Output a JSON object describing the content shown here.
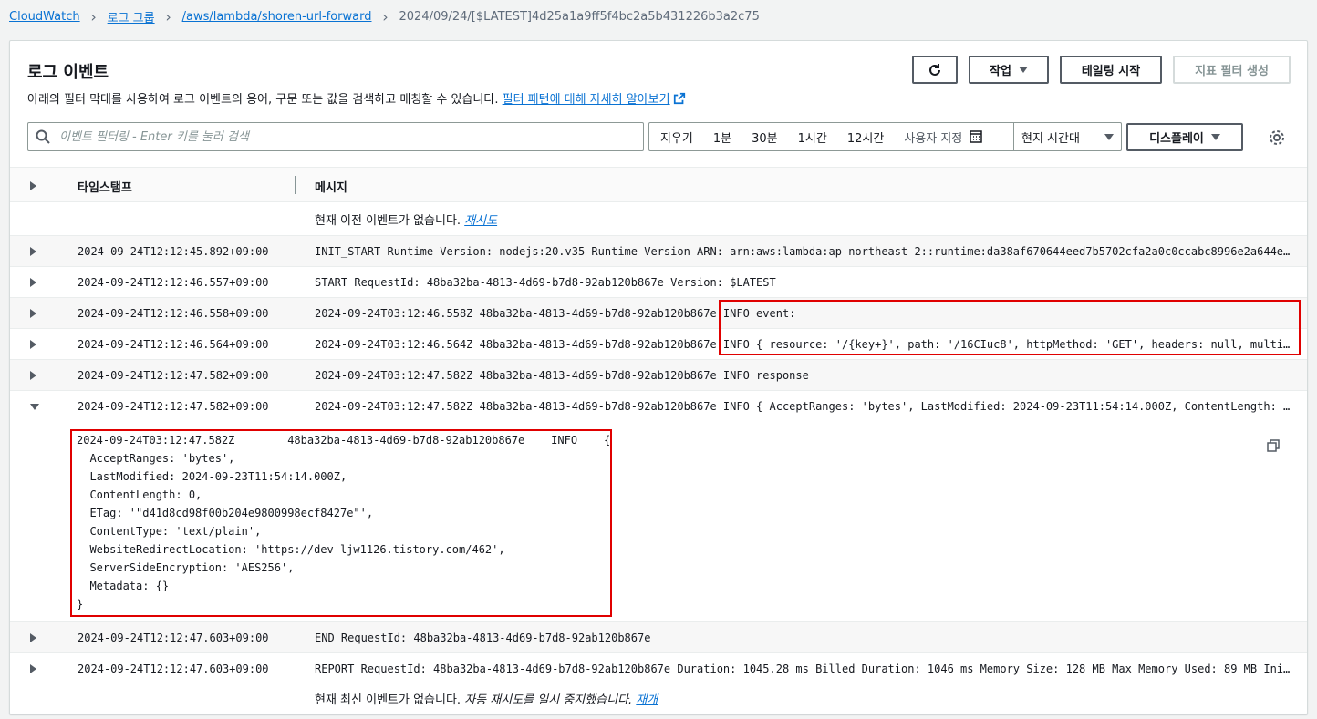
{
  "breadcrumb": {
    "items": [
      "CloudWatch",
      "로그 그룹",
      "/aws/lambda/shoren-url-forward"
    ],
    "current": "2024/09/24/[$LATEST]4d25a1a9ff5f4bc2a5b431226b3a2c75"
  },
  "header": {
    "title": "로그 이벤트",
    "description": "아래의 필터 막대를 사용하여 로그 이벤트의 용어, 구문 또는 값을 검색하고 매칭할 수 있습니다.",
    "learn_more": "필터 패턴에 대해 자세히 알아보기",
    "refresh_icon": "refresh-icon",
    "actions_label": "작업",
    "tailing_label": "테일링 시작",
    "metric_filter_label": "지표 필터 생성"
  },
  "filter": {
    "placeholder": "이벤트 필터링 - Enter 키를 눌러 검색",
    "ranges": [
      "지우기",
      "1분",
      "30분",
      "1시간",
      "12시간"
    ],
    "custom_label": "사용자 지정",
    "timezone": "현지 시간대",
    "display_label": "디스플레이"
  },
  "table": {
    "col_timestamp": "타임스탬프",
    "col_message": "메시지",
    "no_older": "현재 이전 이벤트가 없습니다.",
    "retry": "재시도",
    "no_newer": "현재 최신 이벤트가 없습니다.",
    "paused": "자동 재시도를 일시 중지했습니다.",
    "resume": "재개",
    "rows": [
      {
        "ts": "2024-09-24T12:12:45.892+09:00",
        "msg": "INIT_START Runtime Version: nodejs:20.v35 Runtime Version ARN: arn:aws:lambda:ap-northeast-2::runtime:da38af670644eed7b5702cfa2a0c0ccabc8996e2a644e..."
      },
      {
        "ts": "2024-09-24T12:12:46.557+09:00",
        "msg": "START RequestId: 48ba32ba-4813-4d69-b7d8-92ab120b867e Version: $LATEST"
      },
      {
        "ts": "2024-09-24T12:12:46.558+09:00",
        "msg": "2024-09-24T03:12:46.558Z 48ba32ba-4813-4d69-b7d8-92ab120b867e INFO event:"
      },
      {
        "ts": "2024-09-24T12:12:46.564+09:00",
        "msg": "2024-09-24T03:12:46.564Z 48ba32ba-4813-4d69-b7d8-92ab120b867e INFO { resource: '/{key+}', path: '/16CIuc8', httpMethod: 'GET', headers: null, multi..."
      },
      {
        "ts": "2024-09-24T12:12:47.582+09:00",
        "msg": "2024-09-24T03:12:47.582Z 48ba32ba-4813-4d69-b7d8-92ab120b867e INFO response"
      },
      {
        "ts": "2024-09-24T12:12:47.582+09:00",
        "msg": "2024-09-24T03:12:47.582Z 48ba32ba-4813-4d69-b7d8-92ab120b867e INFO { AcceptRanges: 'bytes', LastModified: 2024-09-23T11:54:14.000Z, ContentLength: ..."
      },
      {
        "ts": "2024-09-24T12:12:47.603+09:00",
        "msg": "END RequestId: 48ba32ba-4813-4d69-b7d8-92ab120b867e"
      },
      {
        "ts": "2024-09-24T12:12:47.603+09:00",
        "msg": "REPORT RequestId: 48ba32ba-4813-4d69-b7d8-92ab120b867e Duration: 1045.28 ms Billed Duration: 1046 ms Memory Size: 128 MB Max Memory Used: 89 MB Ini..."
      }
    ],
    "expanded_lines": [
      "2024-09-24T03:12:47.582Z\t48ba32ba-4813-4d69-b7d8-92ab120b867e\tINFO\t{",
      "  AcceptRanges: 'bytes',",
      "  LastModified: 2024-09-23T11:54:14.000Z,",
      "  ContentLength: 0,",
      "  ETag: '\"d41d8cd98f00b204e9800998ecf8427e\"',",
      "  ContentType: 'text/plain',",
      "  WebsiteRedirectLocation: 'https://dev-ljw1126.tistory.com/462',",
      "  ServerSideEncryption: 'AES256',",
      "  Metadata: {}",
      "}"
    ]
  },
  "colors": {
    "link": "#0972d3",
    "highlight": "#e00000"
  }
}
